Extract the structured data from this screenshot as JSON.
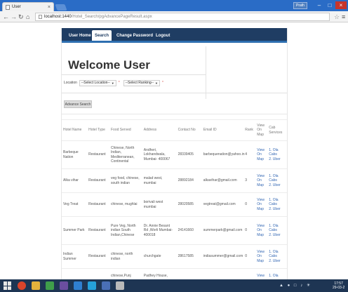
{
  "browser": {
    "tab_title": "User",
    "tab_close": "×",
    "user_badge": "Prath",
    "window_controls": {
      "minimize": "–",
      "maximize": "□",
      "close": "×"
    },
    "url_host": "localhost:1440",
    "url_path": "/Hotel_Search/pgAdvancePageResult.aspx",
    "icons": [
      "back-arrow-icon",
      "forward-arrow-icon",
      "reload-icon",
      "home-icon",
      "bookmark-star-icon",
      "menu-icon"
    ]
  },
  "navbar": {
    "items": [
      {
        "label": "User Home"
      },
      {
        "label": "Search"
      },
      {
        "label": "Change Password"
      },
      {
        "label": "Logout"
      }
    ],
    "active_color": "#ffffff",
    "bar_color": "#1f3d63"
  },
  "page": {
    "welcome": "Welcome User",
    "location_label": "Location",
    "location_select": "--Select Location--",
    "ranking_select": "--Select Ranking--",
    "advance_search_button": "Advance Search"
  },
  "table": {
    "headers": [
      "Hotel Name",
      "Hotel Type",
      "Food Served",
      "Address",
      "Contact No",
      "Email ID",
      "Rank",
      "View On Map",
      "Cab Services"
    ],
    "rows": [
      {
        "name": "Barbeque Nation",
        "type": "Restaurant",
        "food": "Chinese, North Indian, Mediterranean, Continental",
        "address": "Andheri, Lokhandwala, Mumbai- 400067",
        "contact": "28339405",
        "email": "barbequenation@yahoo.in",
        "rank": "4",
        "map": "View On Map",
        "cabs": [
          "1. Ola",
          "Cabs",
          "2. Uber"
        ]
      },
      {
        "name": "Alka vihar",
        "type": "Restaurant",
        "food": "veg food, chinese, south indian",
        "address": "malad west, mumbai",
        "contact": "28892184",
        "email": "alkavihar@gmail.com",
        "rank": "3",
        "map": "View On Map",
        "cabs": [
          "1. Ola",
          "Cabs",
          "2. Uber"
        ]
      },
      {
        "name": "Veg Treat",
        "type": "Restaurant",
        "food": "chinese, mughlai",
        "address": "borivali west mumbai",
        "contact": "28020585",
        "email": "vegtreat@gmail.com",
        "rank": "0",
        "map": "View On Map",
        "cabs": [
          "1. Ola",
          "Cabs",
          "2. Uber"
        ]
      },
      {
        "name": "Summer Park",
        "type": "Restaurant",
        "food": "Pure Veg, North indian South Indian,Chinese",
        "address": "Dr. Annie Besant Rd ,Worli Mumbai-400018",
        "contact": "24141660",
        "email": "summerpark@gmail.com",
        "rank": "0",
        "map": "View On Map",
        "cabs": [
          "1. Ola",
          "Cabs",
          "2. Uber"
        ]
      },
      {
        "name": "Indian Summer",
        "type": "Restaurant",
        "food": "chinese, north indian",
        "address": "churchgate",
        "contact": "28617585",
        "email": "indiasummer@gmail.com",
        "rank": "0",
        "map": "View On Map",
        "cabs": [
          "1. Ola",
          "Cabs",
          "2. Uber"
        ]
      },
      {
        "name": "",
        "type": "",
        "food": "chinese,Punj",
        "address": "Padhey House,",
        "contact": "",
        "email": "",
        "rank": "",
        "map": "View",
        "cabs": [
          "1. Ola"
        ]
      }
    ]
  },
  "taskbar": {
    "time": "17:57",
    "date": "29-03-2",
    "app_icons": [
      "windows-start-icon",
      "chrome-icon",
      "file-explorer-icon",
      "sticky-notes-icon",
      "visual-studio-icon",
      "media-icon",
      "skype-icon",
      "app-icon",
      "paint-icon"
    ]
  }
}
